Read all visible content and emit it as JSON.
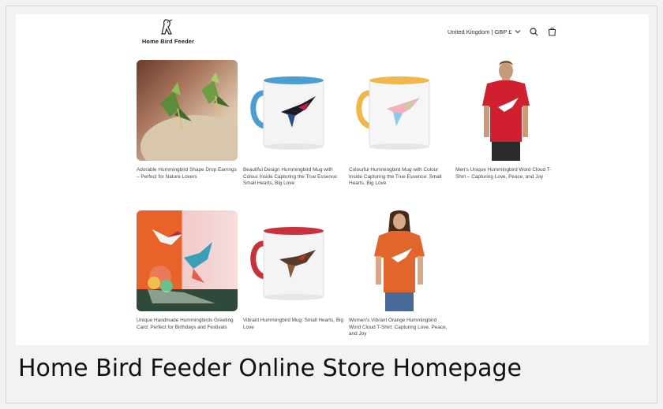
{
  "store": {
    "name": "Home Bird Feeder"
  },
  "header": {
    "locale": "United Kingdom | GBP £",
    "icons": [
      "search-icon",
      "cart-icon"
    ]
  },
  "products": [
    {
      "title": "Adorable Hummingbird Shape Drop Earrings – Perfect for Nature Lovers",
      "image": "green hummingbird earrings photo"
    },
    {
      "title": "Beautiful Design Hummingbird Mug with Colour Inside Capturing the True Essence: Small Hearts, Big Love",
      "image": "mug with blue handle and rim"
    },
    {
      "title": "Colourful Hummingbird Mug with Colour Inside Capturing the True Essence: Small Hearts, Big Love",
      "image": "mug with yellow handle and rim"
    },
    {
      "title": "Men's Unique Hummingbird Word Cloud T-Shirt – Capturing Love, Peace, and Joy",
      "image": "man in red t-shirt"
    },
    {
      "title": "Unique Handmade Hummingbirds Greeting Card: Perfect for Birthdays and Festivals",
      "image": "pop-up hummingbird card"
    },
    {
      "title": "Vibrant Hummingbird Mug: Small Hearts, Big Love",
      "image": "mug with red handle and rim"
    },
    {
      "title": "Women's Vibrant Orange Hummingbird Word Cloud T-Shirt: Capturing Love, Peace, and Joy",
      "image": "woman in orange t-shirt"
    }
  ],
  "caption": "Home Bird Feeder Online Store Homepage",
  "colors": {
    "blue_mug": "#4a9ed1",
    "yellow_mug": "#f0b84a",
    "red_mug": "#c8323a",
    "red_shirt": "#d0202f",
    "orange_shirt": "#e2652c"
  }
}
